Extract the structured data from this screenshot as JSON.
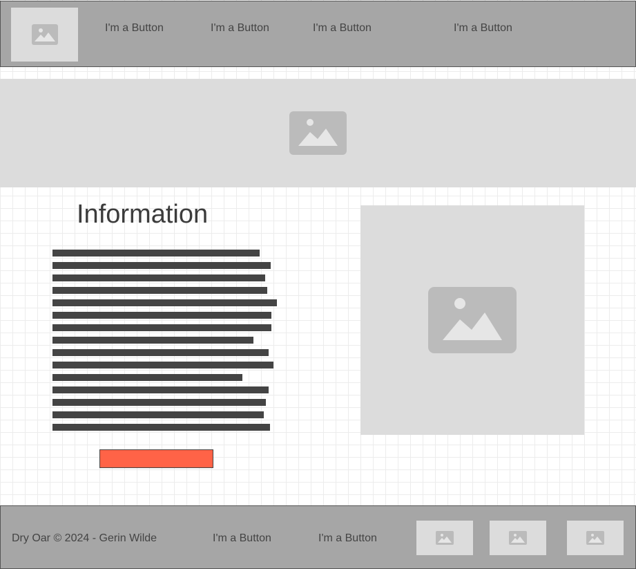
{
  "header": {
    "nav": [
      {
        "label": "I'm a Button"
      },
      {
        "label": "I'm a Button"
      },
      {
        "label": "I'm a Button"
      },
      {
        "label": "I'm a Button"
      }
    ],
    "logo_icon": "image-placeholder-icon"
  },
  "hero": {
    "icon": "image-placeholder-icon"
  },
  "main": {
    "title": "Information",
    "placeholder_line_count": 15,
    "cta_color": "#ff6347",
    "side_image_icon": "image-placeholder-icon"
  },
  "footer": {
    "copyright": "Dry Oar © 2024 - Gerin Wilde",
    "links": [
      {
        "label": "I'm a Button"
      },
      {
        "label": "I'm a Button"
      }
    ],
    "images": [
      "image-placeholder-icon",
      "image-placeholder-icon",
      "image-placeholder-icon"
    ]
  },
  "colors": {
    "bar_bg": "#a6a6a6",
    "placeholder_bg": "#dcdcdc",
    "placeholder_icon": "#bbbbbb",
    "text": "#444444",
    "accent": "#ff6347"
  }
}
